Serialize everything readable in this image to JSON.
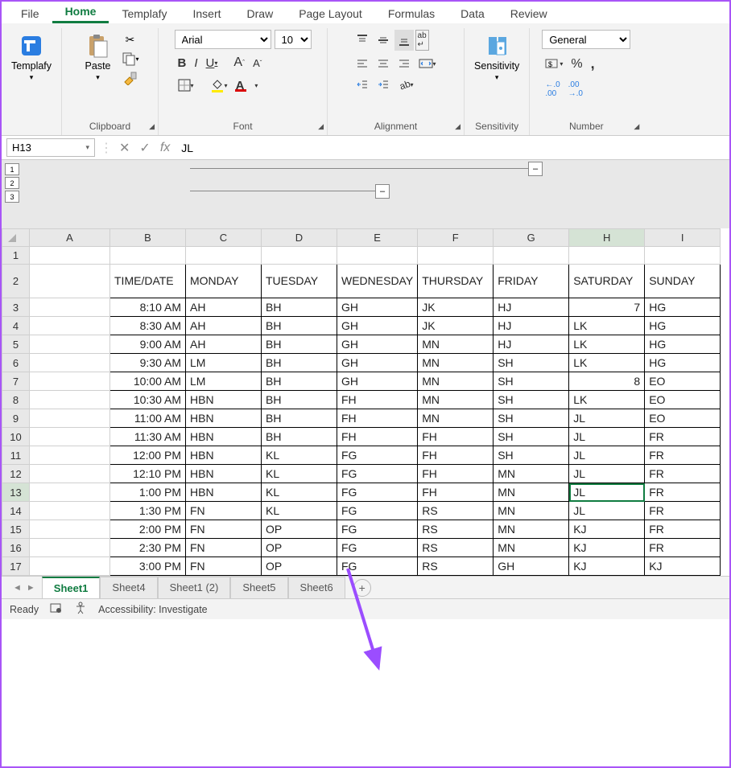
{
  "tabs": [
    "File",
    "Home",
    "Templafy",
    "Insert",
    "Draw",
    "Page Layout",
    "Formulas",
    "Data",
    "Review"
  ],
  "active_tab": "Home",
  "groups": {
    "templafy": "Templafy",
    "clipboard": "Clipboard",
    "paste": "Paste",
    "font": "Font",
    "alignment": "Alignment",
    "sensitivity": "Sensitivity",
    "number": "Number"
  },
  "font": {
    "name": "Arial",
    "size": "10"
  },
  "number_format": "General",
  "namebox": "H13",
  "formula": "JL",
  "outline": {
    "levels": [
      "1",
      "2",
      "3"
    ],
    "btn1": "–",
    "btn2": "–"
  },
  "columns": [
    "A",
    "B",
    "C",
    "D",
    "E",
    "F",
    "G",
    "H",
    "I"
  ],
  "rows": [
    1,
    2,
    3,
    4,
    5,
    6,
    7,
    8,
    9,
    10,
    11,
    12,
    13,
    14,
    15,
    16,
    17
  ],
  "headers": [
    "TIME/DATE",
    "MONDAY",
    "TUESDAY",
    "WEDNESDAY",
    "THURSDAY",
    "FRIDAY",
    "SATURDAY",
    "SUNDAY"
  ],
  "data": [
    [
      "8:10 AM",
      "AH",
      "BH",
      "GH",
      "JK",
      "HJ",
      "7",
      "HG"
    ],
    [
      "8:30 AM",
      "AH",
      "BH",
      "GH",
      "JK",
      "HJ",
      "LK",
      "HG"
    ],
    [
      "9:00 AM",
      "AH",
      "BH",
      "GH",
      "MN",
      "HJ",
      "LK",
      "HG"
    ],
    [
      "9:30 AM",
      "LM",
      "BH",
      "GH",
      "MN",
      "SH",
      "LK",
      "HG"
    ],
    [
      "10:00 AM",
      "LM",
      "BH",
      "GH",
      "MN",
      "SH",
      "8",
      "EO"
    ],
    [
      "10:30 AM",
      "HBN",
      "BH",
      "FH",
      "MN",
      "SH",
      "LK",
      "EO"
    ],
    [
      "11:00 AM",
      "HBN",
      "BH",
      "FH",
      "MN",
      "SH",
      "JL",
      "EO"
    ],
    [
      "11:30 AM",
      "HBN",
      "BH",
      "FH",
      "FH",
      "SH",
      "JL",
      "FR"
    ],
    [
      "12:00 PM",
      "HBN",
      "KL",
      "FG",
      "FH",
      "SH",
      "JL",
      "FR"
    ],
    [
      "12:10 PM",
      "HBN",
      "KL",
      "FG",
      "FH",
      "MN",
      "JL",
      "FR"
    ],
    [
      "1:00 PM",
      "HBN",
      "KL",
      "FG",
      "FH",
      "MN",
      "JL",
      "FR"
    ],
    [
      "1:30 PM",
      "FN",
      "KL",
      "FG",
      "RS",
      "MN",
      "JL",
      "FR"
    ],
    [
      "2:00 PM",
      "FN",
      "OP",
      "FG",
      "RS",
      "MN",
      "KJ",
      "FR"
    ],
    [
      "2:30 PM",
      "FN",
      "OP",
      "FG",
      "RS",
      "MN",
      "KJ",
      "FR"
    ],
    [
      "3:00 PM",
      "FN",
      "OP",
      "FG",
      "RS",
      "GH",
      "KJ",
      "KJ"
    ]
  ],
  "numeric_cols_for_h": [
    0,
    4
  ],
  "selected_cell": {
    "row": 13,
    "col": "H"
  },
  "sheet_tabs": [
    "Sheet1",
    "Sheet4",
    "Sheet1 (2)",
    "Sheet5",
    "Sheet6"
  ],
  "active_sheet": "Sheet1",
  "status": {
    "ready": "Ready",
    "accessibility": "Accessibility: Investigate"
  }
}
